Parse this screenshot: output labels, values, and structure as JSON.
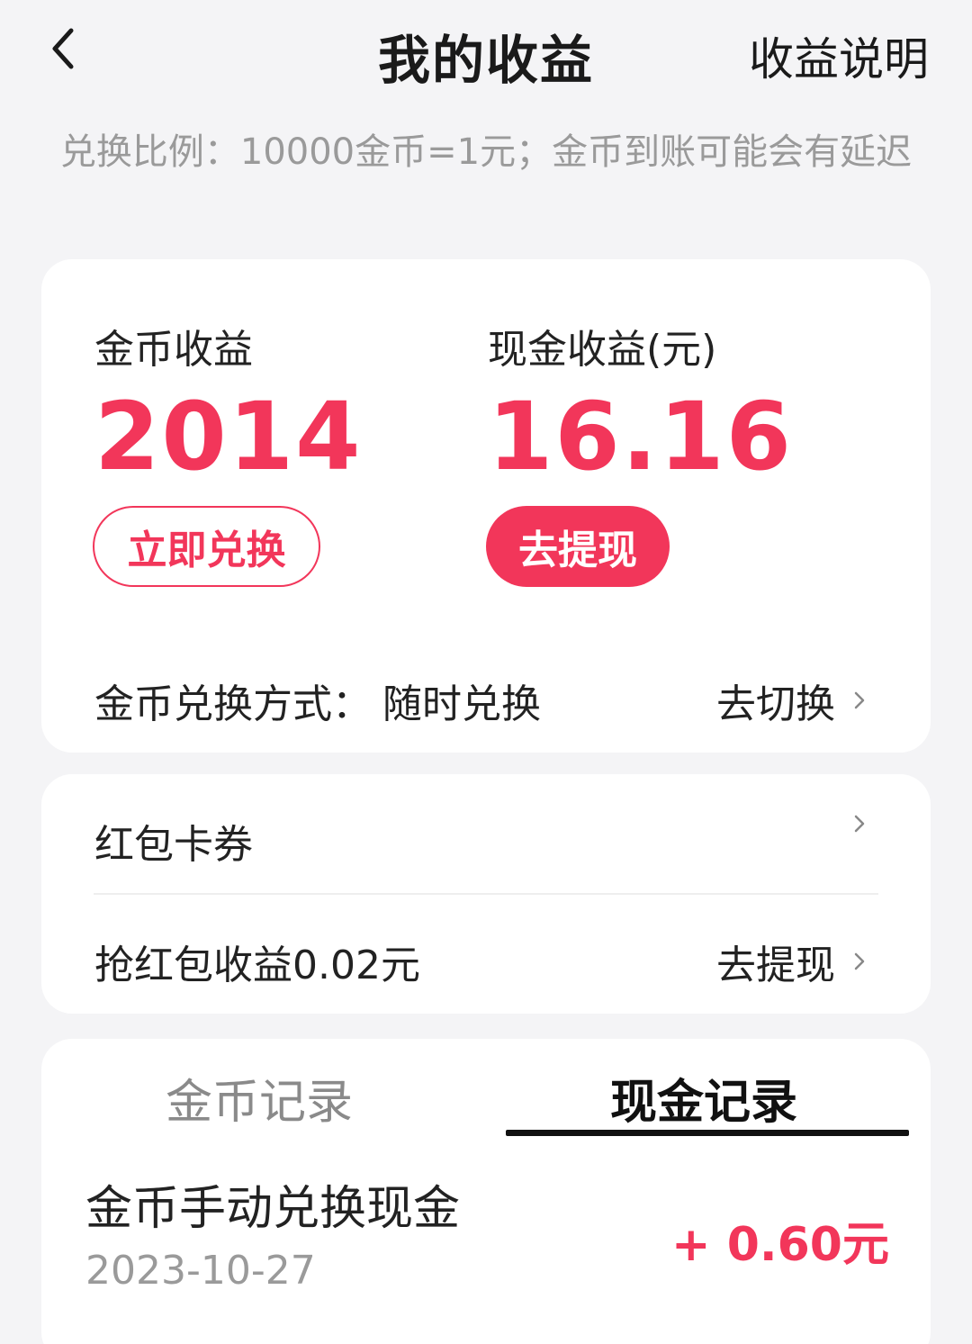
{
  "header": {
    "title": "我的收益",
    "explain_link": "收益说明"
  },
  "notice": "兑换比例：10000金币=1元；金币到账可能会有延迟",
  "earnings": {
    "coin": {
      "label": "金币收益",
      "value": "2014",
      "button": "立即兑换"
    },
    "cash": {
      "label": "现金收益(元)",
      "value": "16.16",
      "button": "去提现"
    },
    "exchange_mode": {
      "label": "金币兑换方式：",
      "value": "随时兑换",
      "action": "去切换"
    }
  },
  "coupons": {
    "red_packet_cards": "红包卡券",
    "grab_earnings": "抢红包收益0.02元",
    "grab_action": "去提现"
  },
  "records": {
    "tabs": [
      "金币记录",
      "现金记录"
    ],
    "active_tab": 1,
    "items": [
      {
        "title": "金币手动兑换现金",
        "date": "2023-10-27",
        "amount": "+ 0.60元"
      }
    ]
  },
  "colors": {
    "accent": "#f2365a",
    "background": "#f4f4f6",
    "card": "#ffffff",
    "muted": "#9a9a9a"
  },
  "icons": {
    "back": "chevron-left-icon",
    "row_arrow": "chevron-right-icon"
  }
}
